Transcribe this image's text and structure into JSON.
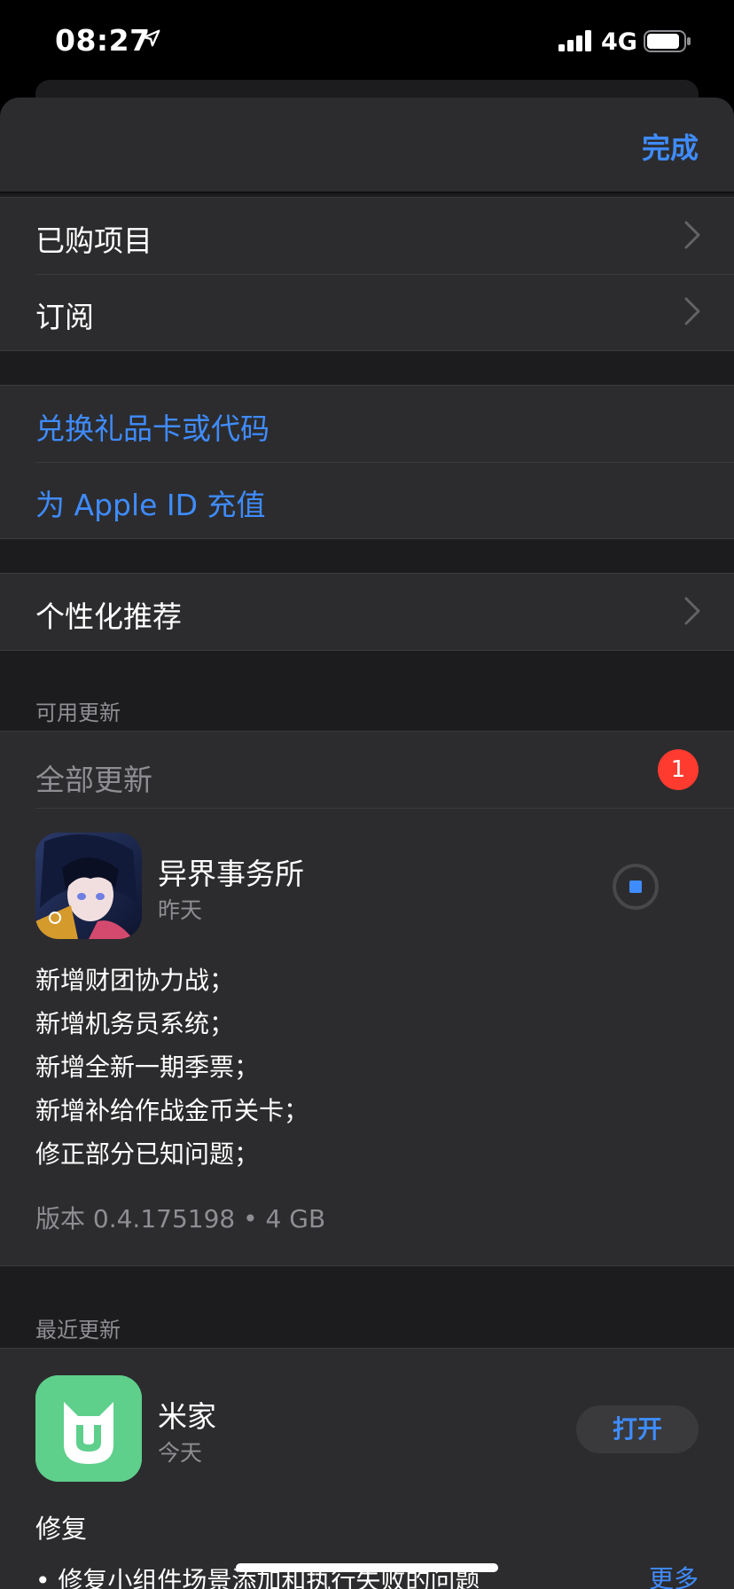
{
  "status_bar": {
    "time": "08:27",
    "network": "4G",
    "icons": [
      "location-arrow-icon",
      "signal-bars-icon",
      "battery-icon"
    ]
  },
  "header": {
    "done_label": "完成"
  },
  "account_group": {
    "items": [
      {
        "label": "已购项目",
        "icon": "chevron-right-icon"
      },
      {
        "label": "订阅",
        "icon": "chevron-right-icon"
      }
    ]
  },
  "gift_group": {
    "items": [
      {
        "label": "兑换礼品卡或代码"
      },
      {
        "label": "为 Apple ID 充值"
      }
    ]
  },
  "personal_group": {
    "items": [
      {
        "label": "个性化推荐",
        "icon": "chevron-right-icon"
      }
    ]
  },
  "available_updates": {
    "section_title": "可用更新",
    "update_all_label": "全部更新",
    "badge_count": "1",
    "app": {
      "name": "异界事务所",
      "date": "昨天",
      "notes": [
        "新增财团协力战；",
        "新增机务员系统；",
        "新增全新一期季票；",
        "新增补给作战金币关卡；",
        "修正部分已知问题；"
      ],
      "version": "版本 0.4.175198 • 4 GB"
    }
  },
  "recent_updates": {
    "section_title": "最近更新",
    "app": {
      "name": "米家",
      "date": "今天",
      "open_label": "打开",
      "fix_title": "修复",
      "fix_item": "• 修复小组件场景添加和执行失败的问题",
      "more_label": "更多"
    }
  },
  "colors": {
    "accent": "#3f8cff",
    "badge": "#ff3b30",
    "mijia_icon": "#5fcf8c",
    "background": "#1c1c1e",
    "cell": "#2c2c2e"
  }
}
